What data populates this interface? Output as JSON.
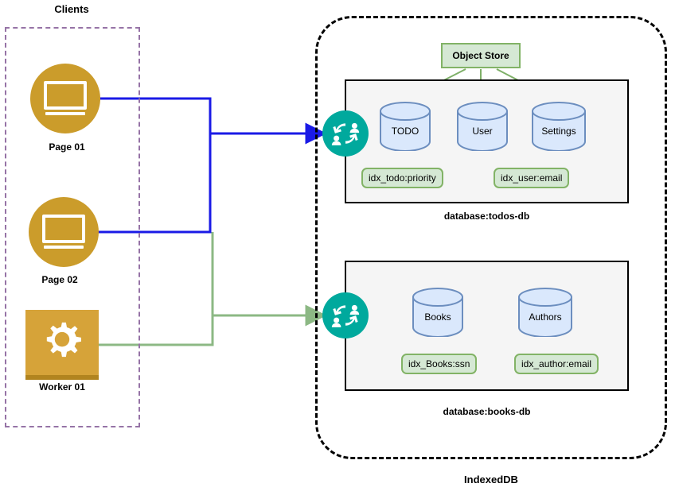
{
  "clients": {
    "group_label": "Clients",
    "nodes": [
      {
        "id": "page-01",
        "label": "Page 01",
        "icon": "monitor-icon",
        "color": "#cb9c2b"
      },
      {
        "id": "page-02",
        "label": "Page 02",
        "icon": "monitor-icon",
        "color": "#cb9c2b"
      },
      {
        "id": "worker-01",
        "label": "Worker 01",
        "icon": "gear-icon",
        "color": "#d6a339"
      }
    ]
  },
  "indexeddb": {
    "label": "IndexedDB",
    "object_store_label": "Object Store",
    "databases": [
      {
        "id": "todos-db",
        "caption": "database:todos-db",
        "sync_icon": "sync-users-icon",
        "stores": [
          {
            "name": "TODO"
          },
          {
            "name": "User"
          },
          {
            "name": "Settings"
          }
        ],
        "indexes": [
          {
            "name": "idx_todo:priority"
          },
          {
            "name": "idx_user:email"
          }
        ]
      },
      {
        "id": "books-db",
        "caption": "database:books-db",
        "sync_icon": "sync-users-icon",
        "stores": [
          {
            "name": "Books"
          },
          {
            "name": "Authors"
          }
        ],
        "indexes": [
          {
            "name": "idx_Books:ssn"
          },
          {
            "name": "idx_author:email"
          }
        ]
      }
    ]
  },
  "colors": {
    "client_group_border": "#9673a6",
    "client_fill": "#cb9c2b",
    "worker_fill": "#d6a339",
    "sync_teal": "#00a99d",
    "store_fill": "#dae8fc",
    "store_border": "#6c8ebf",
    "green_fill": "#d5e8d4",
    "green_border": "#82b366",
    "blue_link": "#1a1ae6",
    "green_link": "#8cb884",
    "panel_fill": "#f5f5f5",
    "panel_border": "#000000"
  }
}
